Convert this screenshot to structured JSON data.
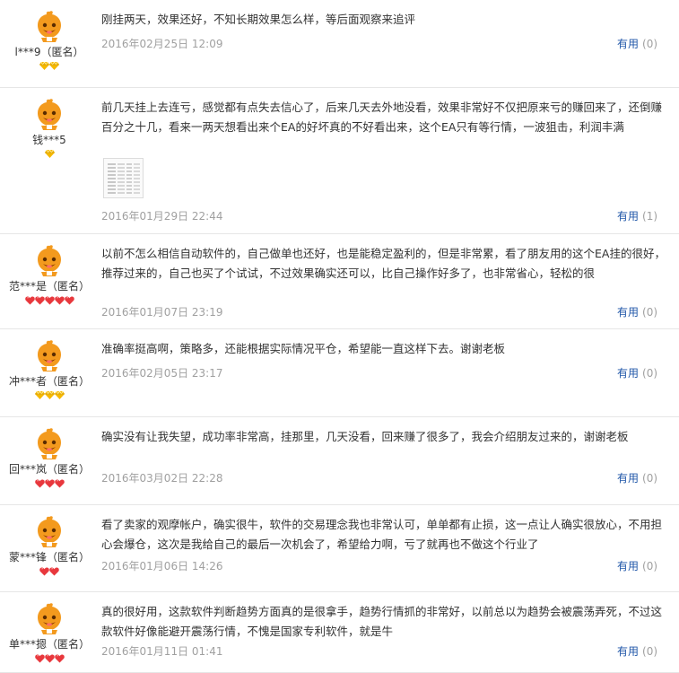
{
  "reviews": [
    {
      "user": "l***9（匿名）",
      "rank": "diamond",
      "rank_count": 2,
      "content": "刚挂两天，效果还好，不知长期效果怎么样，等后面观察来追评",
      "date": "2016年02月25日 12:09",
      "useful_label": "有用",
      "useful_count": "(0)",
      "has_image": false
    },
    {
      "user": "钱***5",
      "rank": "diamond",
      "rank_count": 1,
      "content": "前几天挂上去连亏，感觉都有点失去信心了，后来几天去外地没看，效果非常好不仅把原来亏的赚回来了，还倒赚百分之十几，看来一两天想看出来个EA的好坏真的不好看出来，这个EA只有等行情，一波狙击，利润丰满",
      "date": "2016年01月29日 22:44",
      "useful_label": "有用",
      "useful_count": "(1)",
      "has_image": true
    },
    {
      "user": "范***是（匿名）",
      "rank": "heart",
      "rank_count": 5,
      "content": "以前不怎么相信自动软件的，自己做单也还好，也是能稳定盈利的，但是非常累，看了朋友用的这个EA挂的很好，推荐过来的，自己也买了个试试，不过效果确实还可以，比自己操作好多了，也非常省心，轻松的很",
      "date": "2016年01月07日 23:19",
      "useful_label": "有用",
      "useful_count": "(0)",
      "has_image": false
    },
    {
      "user": "冲***者（匿名）",
      "rank": "diamond",
      "rank_count": 3,
      "content": "准确率挺高啊，策略多，还能根据实际情况平仓，希望能一直这样下去。谢谢老板",
      "date": "2016年02月05日 23:17",
      "useful_label": "有用",
      "useful_count": "(0)",
      "has_image": false
    },
    {
      "user": "回***岚（匿名）",
      "rank": "heart",
      "rank_count": 3,
      "content": "确实没有让我失望，成功率非常高，挂那里，几天没看，回来赚了很多了，我会介绍朋友过来的，谢谢老板",
      "date": "2016年03月02日 22:28",
      "useful_label": "有用",
      "useful_count": "(0)",
      "has_image": false
    },
    {
      "user": "蒙***锋（匿名）",
      "rank": "heart",
      "rank_count": 2,
      "content": "看了卖家的观摩帐户，确实很牛，软件的交易理念我也非常认可，单单都有止损，这一点让人确实很放心，不用担心会爆仓，这次是我给自己的最后一次机会了，希望给力啊，亏了就再也不做这个行业了",
      "date": "2016年01月06日 14:26",
      "useful_label": "有用",
      "useful_count": "(0)",
      "has_image": false
    },
    {
      "user": "单***摁（匿名）",
      "rank": "heart",
      "rank_count": 3,
      "content": "真的很好用，这款软件判断趋势方面真的是很拿手，趋势行情抓的非常好，以前总以为趋势会被震荡弄死，不过这款软件好像能避开震荡行情，不愧是国家专利软件，就是牛",
      "date": "2016年01月11日 01:41",
      "useful_label": "有用",
      "useful_count": "(0)",
      "has_image": false
    }
  ],
  "colors": {
    "link": "#1f56a8",
    "date": "#a0a0a0",
    "diamond": "#f5b800",
    "heart": "#e8383d",
    "avatar": "#f39a1e"
  },
  "icons": {
    "avatar": "cartoon-avatar-icon",
    "diamond": "diamond-rank-icon",
    "heart": "heart-rank-icon"
  }
}
